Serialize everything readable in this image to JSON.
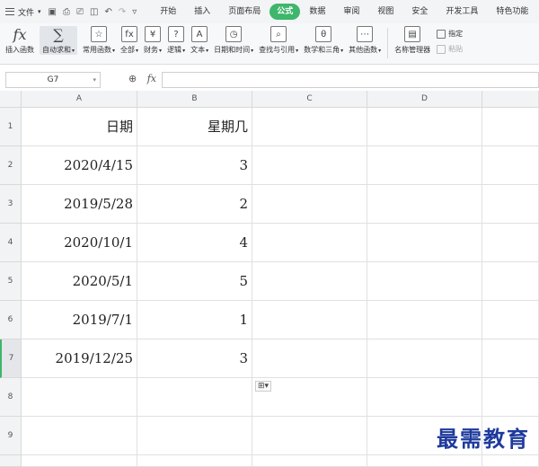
{
  "menubar": {
    "file_label": "文件",
    "tabs": [
      "开始",
      "插入",
      "页面布局",
      "公式",
      "数据",
      "审阅",
      "视图",
      "安全",
      "开发工具",
      "特色功能"
    ],
    "active_tab": "公式"
  },
  "ribbon": {
    "insert_function": "插入函数",
    "autosum": "自动求和",
    "common_functions": "常用函数",
    "all": "全部",
    "finance": "财务",
    "logic": "逻辑",
    "text": "文本",
    "datetime": "日期和时间",
    "lookup": "查找与引用",
    "math": "数学和三角",
    "other": "其他函数",
    "name_manager": "名称管理器",
    "specify": "指定",
    "paste": "粘贴"
  },
  "formula_bar": {
    "cell_ref": "G7",
    "fx_label": "fx",
    "value": ""
  },
  "columns": [
    "A",
    "B",
    "C",
    "D"
  ],
  "rows": [
    "1",
    "2",
    "3",
    "4",
    "5",
    "6",
    "7",
    "8",
    "9"
  ],
  "table": {
    "headers": [
      "日期",
      "星期几"
    ],
    "data": [
      [
        "2020/4/15",
        "3"
      ],
      [
        "2019/5/28",
        "2"
      ],
      [
        "2020/10/1",
        "4"
      ],
      [
        "2020/5/1",
        "5"
      ],
      [
        "2019/7/1",
        "1"
      ],
      [
        "2019/12/25",
        "3"
      ]
    ]
  },
  "watermark": "最需教育",
  "colors": {
    "accent": "#3eb66b",
    "watermark": "#1e3a9c"
  }
}
